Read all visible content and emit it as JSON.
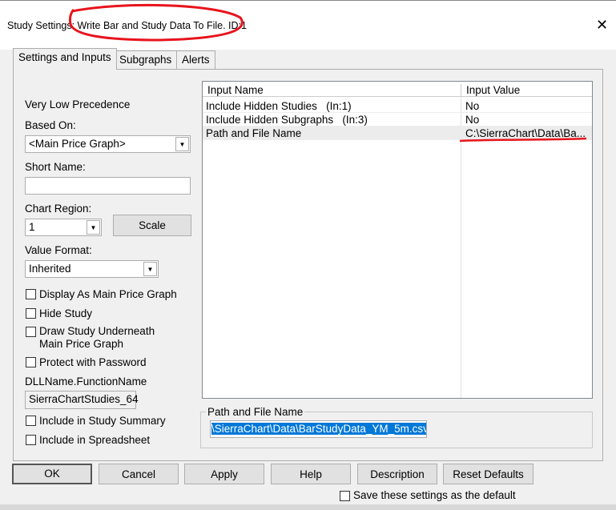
{
  "window": {
    "title": "Study Settings: Write Bar and Study Data To File. ID:1",
    "close_icon": "close-icon"
  },
  "tabs": [
    {
      "label": "Settings and Inputs",
      "active": true
    },
    {
      "label": "Subgraphs"
    },
    {
      "label": "Alerts"
    }
  ],
  "settings": {
    "precedence": "Very Low Precedence",
    "based_on_label": "Based On:",
    "based_on_value": "<Main Price Graph>",
    "short_name_label": "Short Name:",
    "short_name_value": "",
    "chart_region_label": "Chart Region:",
    "chart_region_value": "1",
    "scale_label": "Scale",
    "value_format_label": "Value Format:",
    "value_format_value": "Inherited",
    "checkboxes": [
      {
        "label": "Display As Main Price Graph",
        "checked": false
      },
      {
        "label": "Hide Study",
        "checked": false
      },
      {
        "label": "Draw Study Underneath",
        "label2": "Main Price Graph",
        "checked": false
      },
      {
        "label": "Protect with Password",
        "checked": false
      }
    ],
    "dll_label": "DLLName.FunctionName",
    "dll_value": "SierraChartStudies_64",
    "checkboxes2": [
      {
        "label": "Include in Study Summary",
        "checked": false
      },
      {
        "label": "Include in Spreadsheet",
        "checked": false
      }
    ]
  },
  "inputs": {
    "columns": [
      "Input Name",
      "Input Value"
    ],
    "rows": [
      {
        "name": "Include Hidden Studies   (In:1)",
        "value": "No"
      },
      {
        "name": "Include Hidden Subgraphs   (In:3)",
        "value": "No"
      },
      {
        "name": "Path and File Name",
        "value": "C:\\SierraChart\\Data\\Ba..."
      }
    ]
  },
  "editor": {
    "label": "Path and File Name",
    "value": "\\SierraChart\\Data\\BarStudyData_YM_5m.csv"
  },
  "buttons": {
    "ok": "OK",
    "cancel": "Cancel",
    "apply": "Apply",
    "help": "Help",
    "description": "Description",
    "reset": "Reset Defaults"
  },
  "save_default": {
    "label": "Save these settings as the default",
    "checked": false
  },
  "annotation_color": "#e8141c"
}
